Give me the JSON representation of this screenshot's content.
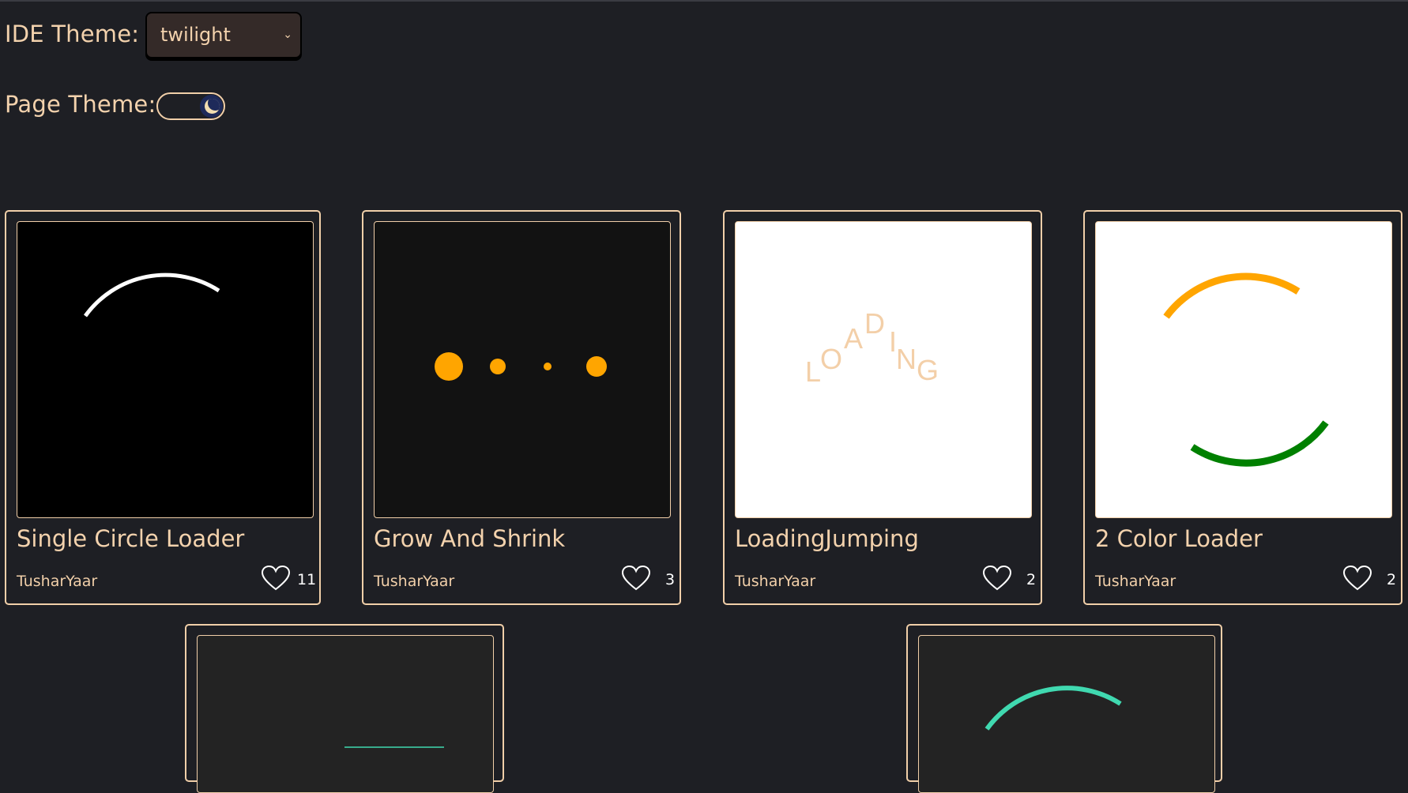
{
  "settings": {
    "ide_theme_label": "IDE Theme:",
    "ide_theme_value": "twilight",
    "page_theme_label": "Page Theme:",
    "page_theme_mode": "dark"
  },
  "cards": [
    {
      "title": "Single Circle Loader",
      "author": "TusharYaar",
      "likes": "11"
    },
    {
      "title": "Grow And Shrink",
      "author": "TusharYaar",
      "likes": "3"
    },
    {
      "title": "LoadingJumping",
      "author": "TusharYaar",
      "likes": "2",
      "letters": [
        "L",
        "O",
        "A",
        "D",
        "I",
        "N",
        "G"
      ]
    },
    {
      "title": "2 Color Loader",
      "author": "TusharYaar",
      "likes": "2"
    }
  ],
  "colors": {
    "background": "#1e1f24",
    "accent": "#f1cfa9",
    "orange": "#ffa500",
    "green": "#008000",
    "teal": "#40d9b0"
  }
}
